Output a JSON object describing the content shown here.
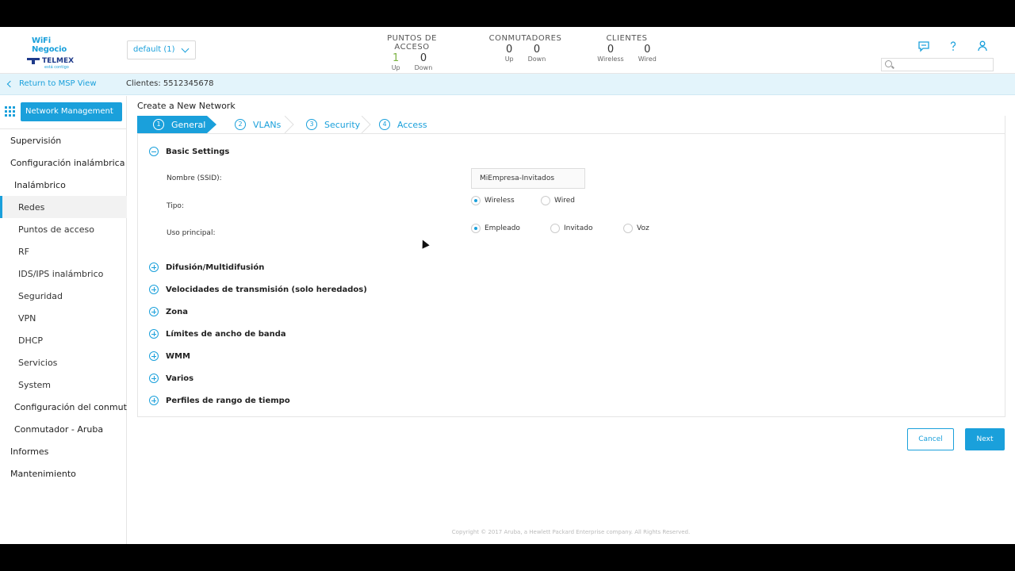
{
  "header": {
    "logo": {
      "brand": "WiFi Negocio",
      "company": "TELMEX",
      "tagline": "está contigo"
    },
    "group_selector": {
      "value": "default (1)"
    },
    "stats": [
      {
        "title": "PUNTOS DE ACCESO",
        "cells": [
          {
            "value": "1",
            "label": "Up"
          },
          {
            "value": "0",
            "label": "Down"
          }
        ]
      },
      {
        "title": "CONMUTADORES",
        "cells": [
          {
            "value": "0",
            "label": "Up"
          },
          {
            "value": "0",
            "label": "Down"
          }
        ]
      },
      {
        "title": "CLIENTES",
        "cells": [
          {
            "value": "0",
            "label": "Wireless"
          },
          {
            "value": "0",
            "label": "Wired"
          }
        ]
      }
    ],
    "icons": [
      "chat-icon",
      "help-icon",
      "user-icon",
      "search-icon"
    ],
    "search": {
      "value": "",
      "placeholder": ""
    }
  },
  "subheader": {
    "back_link": "Return to MSP View",
    "client": "Clientes: 5512345678"
  },
  "sidebar": {
    "app_button": "Network Management",
    "items": [
      {
        "label": "Supervisión",
        "level": 1
      },
      {
        "label": "Configuración inalámbrica",
        "level": 1
      },
      {
        "label": "Inalámbrico",
        "level": 2
      },
      {
        "label": "Redes",
        "level": 3,
        "active": true
      },
      {
        "label": "Puntos de acceso",
        "level": 3
      },
      {
        "label": "RF",
        "level": 3
      },
      {
        "label": "IDS/IPS inalámbrico",
        "level": 3
      },
      {
        "label": "Seguridad",
        "level": 3
      },
      {
        "label": "VPN",
        "level": 3
      },
      {
        "label": "DHCP",
        "level": 3
      },
      {
        "label": "Servicios",
        "level": 3
      },
      {
        "label": "System",
        "level": 3
      },
      {
        "label": "Configuración del conmutador",
        "level": 2
      },
      {
        "label": "Conmutador - Aruba",
        "level": 2
      },
      {
        "label": "Informes",
        "level": 1
      },
      {
        "label": "Mantenimiento",
        "level": 1
      }
    ]
  },
  "main": {
    "title": "Create a New Network",
    "steps": [
      {
        "num": "1",
        "label": "General"
      },
      {
        "num": "2",
        "label": "VLANs"
      },
      {
        "num": "3",
        "label": "Security"
      },
      {
        "num": "4",
        "label": "Access"
      }
    ],
    "basic_settings": {
      "title": "Basic Settings",
      "ssid_label": "Nombre (SSID):",
      "ssid_value": "MiEmpresa-Invitados",
      "type_label": "Tipo:",
      "type_options": [
        "Wireless",
        "Wired"
      ],
      "type_selected": "Wireless",
      "usage_label": "Uso principal:",
      "usage_options": [
        "Empleado",
        "Invitado",
        "Voz"
      ],
      "usage_selected": "Empleado"
    },
    "sections": [
      "Difusión/Multidifusión",
      "Velocidades de transmisión (solo heredados)",
      "Zona",
      "Límites de ancho de banda",
      "WMM",
      "Varios",
      "Perfiles de rango de tiempo"
    ],
    "cancel": "Cancel",
    "next": "Next"
  },
  "footer": {
    "copyright": "Copyright © 2017 Aruba, a Hewlett Packard Enterprise company. All Rights Reserved."
  },
  "colors": {
    "accent": "#1aa0db",
    "up_green": "#7cb342",
    "subheader_bg": "#e3f4fb"
  }
}
